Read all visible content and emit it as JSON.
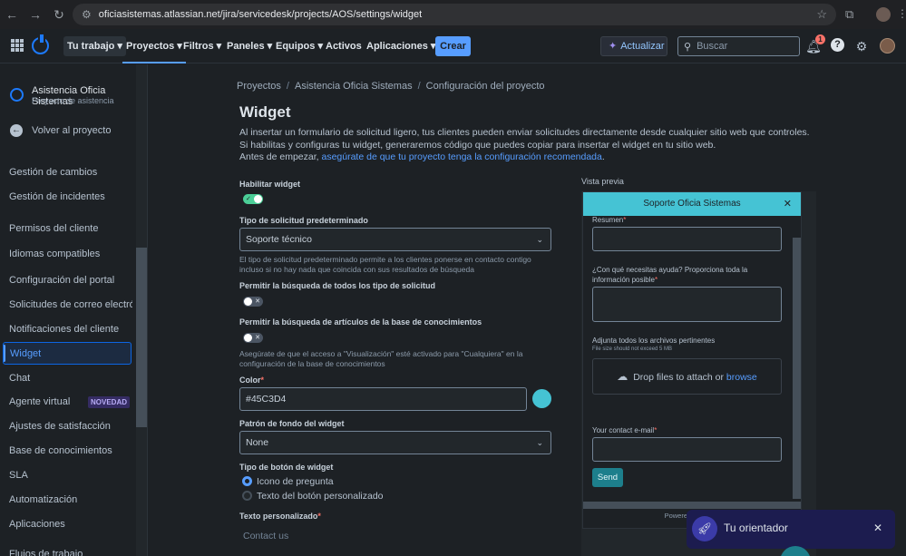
{
  "browser": {
    "url": "oficiasistemas.atlassian.net/jira/servicedesk/projects/AOS/settings/widget"
  },
  "topnav": {
    "items": [
      {
        "label": "Tu trabajo"
      },
      {
        "label": "Proyectos"
      },
      {
        "label": "Filtros"
      },
      {
        "label": "Paneles"
      },
      {
        "label": "Equipos"
      },
      {
        "label": "Activos"
      },
      {
        "label": "Aplicaciones"
      }
    ],
    "create_label": "Crear",
    "upgrade_label": "Actualizar",
    "search_placeholder": "Buscar",
    "notifications_count": "1"
  },
  "sidebar": {
    "project_name": "Asistencia Oficia Sistemas",
    "project_type": "Proyecto de asistencia",
    "back_label": "Volver al proyecto",
    "items": [
      {
        "label": "Gestión de cambios"
      },
      {
        "label": "Gestión de incidentes"
      },
      {
        "label": "Permisos del cliente"
      },
      {
        "label": "Idiomas compatibles"
      },
      {
        "label": "Configuración del portal"
      },
      {
        "label": "Solicitudes de correo electró..."
      },
      {
        "label": "Notificaciones del cliente"
      },
      {
        "label": "Widget"
      },
      {
        "label": "Chat"
      },
      {
        "label": "Agente virtual"
      },
      {
        "label": "Ajustes de satisfacción"
      },
      {
        "label": "Base de conocimientos"
      },
      {
        "label": "SLA"
      },
      {
        "label": "Automatización"
      },
      {
        "label": "Aplicaciones"
      },
      {
        "label": "Flujos de trabajo"
      }
    ],
    "new_badge": "NOVEDAD"
  },
  "breadcrumb": [
    "Proyectos",
    "Asistencia Oficia Sistemas",
    "Configuración del proyecto"
  ],
  "page": {
    "title": "Widget",
    "desc1": "Al insertar un formulario de solicitud ligero, tus clientes pueden enviar solicitudes directamente desde cualquier sitio web que controles.",
    "desc2": "Si habilitas y configuras tu widget, generaremos código que puedes copiar para insertar el widget en tu sitio web.",
    "desc3_prefix": "Antes de empezar,",
    "desc3_link": "asegúrate de que tu proyecto tenga la configuración recomendada",
    "desc3_suffix": "."
  },
  "form": {
    "enable_label": "Habilitar widget",
    "enable_on": true,
    "request_type_label": "Tipo de solicitud predeterminado",
    "request_type_value": "Soporte técnico",
    "request_type_help": "El tipo de solicitud predeterminado permite a los clientes ponerse en contacto contigo incluso si no hay nada que coincida con sus resultados de búsqueda",
    "search_types_label": "Permitir la búsqueda de todos los tipo de solicitud",
    "search_types_on": false,
    "search_kb_label": "Permitir la búsqueda de artículos de la base de conocimientos",
    "search_kb_on": false,
    "search_kb_help": "Asegúrate de que el acceso a \"Visualización\" esté activado para \"Cualquiera\" en la configuración de la base de conocimientos",
    "color_label": "Color",
    "color_value": "#45C3D4",
    "background_label": "Patrón de fondo del widget",
    "background_value": "None",
    "button_type_label": "Tipo de botón de widget",
    "button_option_1": "Icono de pregunta",
    "button_option_2": "Texto del botón personalizado",
    "custom_text_label": "Texto personalizado",
    "custom_text_placeholder": "Contact us"
  },
  "preview": {
    "label": "Vista previa",
    "title": "Soporte Oficia Sistemas",
    "summary_label": "Resumen",
    "help_label": "¿Con qué necesitas ayuda? Proporciona toda la información posible",
    "attach_label": "Adjunta todos los archivos pertinentes",
    "attach_limit": "File size should not exceed 5 MB",
    "drop_text": "Drop files to attach or",
    "browse_text": "browse",
    "email_label": "Your contact e-mail",
    "send_label": "Send",
    "footer": "Powered by Jira S"
  },
  "toast": {
    "label": "Tu orientador"
  },
  "colors": {
    "accent": "#579dff",
    "widget": "#45C3D4",
    "required": "#f87168"
  }
}
